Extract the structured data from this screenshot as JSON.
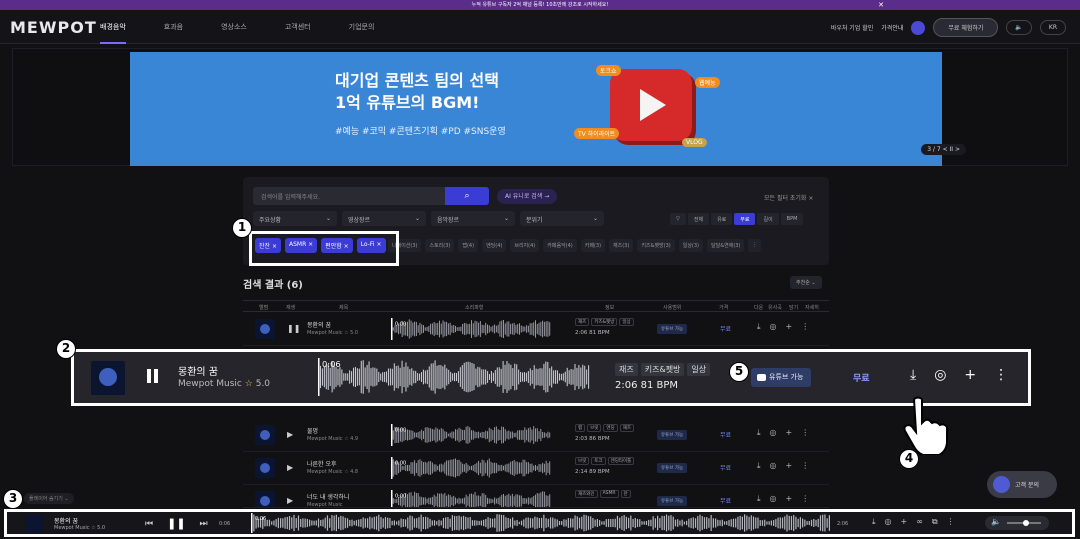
{
  "topbar": {
    "notice": "누적 유튜브 구독자 2억 채널 등록! 10초만에 강조로 시작하세요!",
    "close": "✕"
  },
  "nav": {
    "logo": "MEWPOT",
    "links": [
      "배경음악",
      "효과음",
      "영상소스",
      "고객센터",
      "기업문의"
    ],
    "biz": "바우처 기업 할인",
    "login": "가격안내",
    "cta": "무료 체험하기",
    "lang": "KR"
  },
  "banner": {
    "title_line1": "대기업 콘텐츠 팀의 선택",
    "title_line2": "1억 유튜브의 BGM!",
    "tags": "#예능 #코믹 #콘텐츠기획 #PD #SNS운영",
    "chip_topleft": "토크쇼",
    "chip_topright": "웹예능",
    "chip_bottomleft": "TV 하이라이트",
    "chip_bottomright": "VLOG",
    "pager": "3 / 7   <   II   >"
  },
  "search": {
    "placeholder": "검색어를 입력해주세요.",
    "ai_label": "AI 유니로 검색 →",
    "reset": "모든 필터 초기화 ×",
    "dropdowns": [
      "주요상황",
      "영상장르",
      "음악장르",
      "분위기"
    ],
    "segments": [
      "전체",
      "유료",
      "무료",
      "길이",
      "BPM"
    ],
    "active_segment": "무료",
    "filters": [
      "잔잔 ×",
      "ASMR ×",
      "편안함 ×",
      "Lo-Fi ×"
    ],
    "genres": [
      "나레이션(3)",
      "스토리(3)",
      "랩(4)",
      "엔딩(4)",
      "브리지(4)",
      "카페음악(4)",
      "카페(3)",
      "재즈(3)",
      "키즈&펫방(3)",
      "일상(3)",
      "달달&연애(3)"
    ]
  },
  "results": {
    "title": "검색 결과 (6)",
    "sort": "추천순 ⌄",
    "headers": [
      "앨범",
      "재생",
      "제목",
      "소리파형",
      "정보",
      "사용범위",
      "가격",
      "다운",
      "유사곡",
      "담기",
      "자세히"
    ]
  },
  "rows": [
    {
      "title": "몽환의 꿈",
      "artist": "Mewpot Music ☆ 5.0",
      "time_mark": "0:00",
      "tags": [
        "재즈",
        "키즈&펫방",
        "일상"
      ],
      "meta": "2:06  81 BPM",
      "yt": "유튜브 가능",
      "price": "무료",
      "play": "❚❚"
    },
    {
      "title": "물멍",
      "artist": "Mewpot Music ☆ 4.9",
      "time_mark": "0:00",
      "tags": [
        "랩",
        "브릿",
        "엔딩",
        "재즈"
      ],
      "meta": "2:03  86 BPM",
      "yt": "유튜브 가능",
      "price": "무료",
      "play": "▶"
    },
    {
      "title": "나른한 오후",
      "artist": "Mewpot Music ☆ 4.8",
      "time_mark": "0:00",
      "tags": [
        "브릿",
        "토크",
        "엔딩타이틀"
      ],
      "meta": "2:14  89 BPM",
      "yt": "유튜브 가능",
      "price": "무료",
      "play": "▶"
    },
    {
      "title": "너도 내 생각하니",
      "artist": "Mewpot Music",
      "time_mark": "0:00",
      "tags": [
        "재즈와인",
        "ASMR",
        "잔"
      ],
      "meta": "",
      "yt": "유튜브 가능",
      "price": "무료",
      "play": "▶"
    }
  ],
  "highlight": {
    "title": "몽환의 꿈",
    "artist": "Mewpot Music",
    "rating": "5.0",
    "time_mark": "0:06",
    "tags": [
      "재즈",
      "키즈&펫방",
      "일상"
    ],
    "meta": "2:06   81 BPM",
    "yt": "유튜브 가능",
    "price": "무료"
  },
  "callouts": [
    "1",
    "2",
    "3",
    "4",
    "5"
  ],
  "chat": {
    "label": "고객 문의"
  },
  "player": {
    "hide": "플레이어 숨기기 ⌄",
    "title": "몽환의 꿈",
    "artist": "Mewpot Music ☆ 5.0",
    "elapsed": "0:06",
    "wave_mark": "0:06",
    "duration": "2:06",
    "volume": 0.55
  }
}
